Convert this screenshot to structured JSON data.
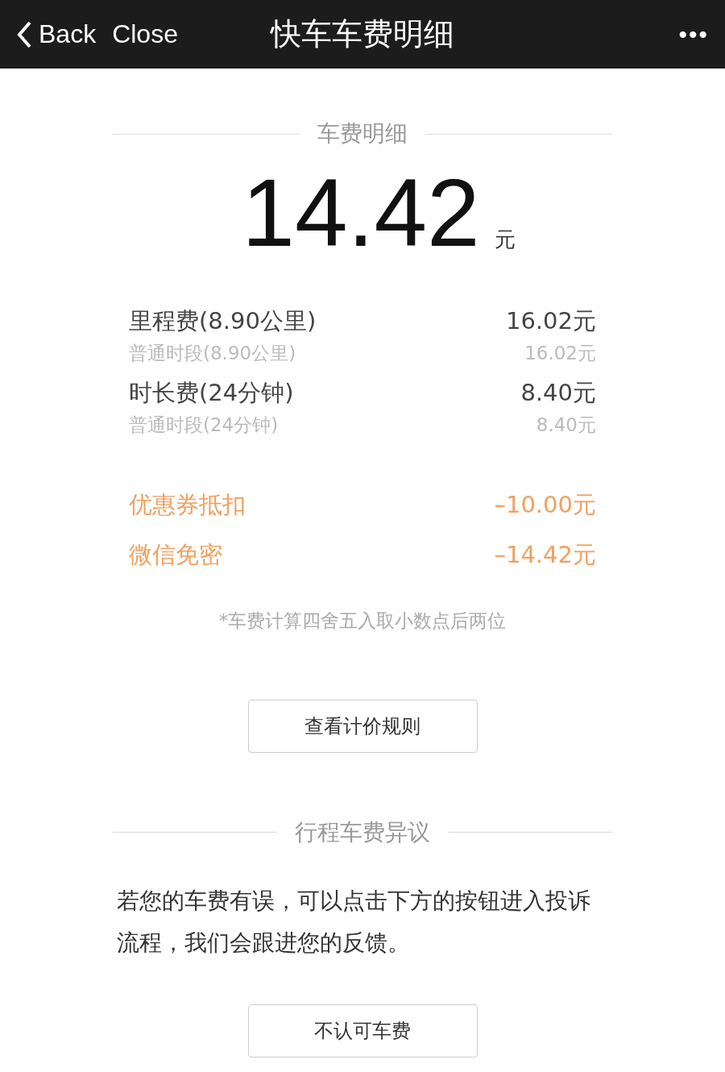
{
  "nav_bar": {
    "back_label": "Back",
    "close_label": "Close",
    "title": "快车车费明细",
    "more": "•••"
  },
  "fare_section": {
    "heading": "车费明细",
    "total": "14.42",
    "currency": "元"
  },
  "items": [
    {
      "kind": "fee",
      "name": "里程费(8.90公里)",
      "amount": "16.02元",
      "sub_name": "普通时段(8.90公里)",
      "sub_amount": "16.02元"
    },
    {
      "kind": "fee",
      "name": "时长费(24分钟)",
      "amount": "8.40元",
      "sub_name": "普通时段(24分钟)",
      "sub_amount": "8.40元"
    },
    {
      "kind": "discount",
      "name": "优惠券抵扣",
      "amount": "–10.00元"
    },
    {
      "kind": "discount",
      "name": "微信免密",
      "amount": "–14.42元"
    }
  ],
  "note": "*车费计算四舍五入取小数点后两位",
  "rules_button": "查看计价规则",
  "dispute_section": {
    "heading": "行程车费异议",
    "text": "若您的车费有误，可以点击下方的按钮进入投诉流程，我们会跟进您的反馈。",
    "button": "不认可车费"
  }
}
